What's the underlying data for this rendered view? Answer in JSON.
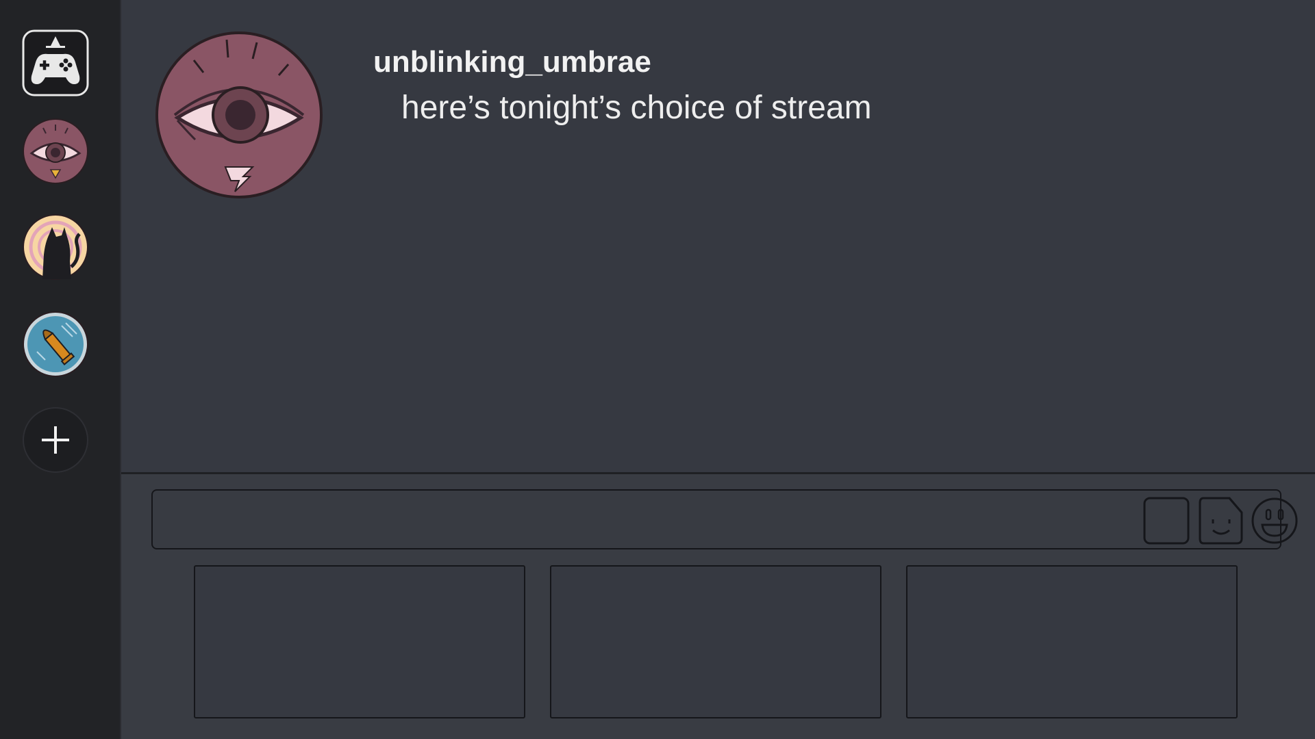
{
  "sidebar": {
    "items": [
      {
        "name": "home",
        "icon": "game-controller-icon"
      },
      {
        "name": "server-eye",
        "icon": "eye-icon"
      },
      {
        "name": "server-cat",
        "icon": "cat-icon"
      },
      {
        "name": "server-bullet",
        "icon": "bullet-icon"
      },
      {
        "name": "add-server",
        "icon": "plus-icon"
      }
    ]
  },
  "message": {
    "author": "unblinking_umbrae",
    "text": "here’s tonight’s choice of stream",
    "avatar_icon": "eye-icon"
  },
  "composer": {
    "placeholder": "",
    "value": "",
    "tools": [
      {
        "name": "box",
        "icon": "square-icon"
      },
      {
        "name": "sticker",
        "icon": "sticker-icon"
      },
      {
        "name": "emoji",
        "icon": "emoji-icon"
      }
    ]
  },
  "stream_options": [
    {
      "label": ""
    },
    {
      "label": ""
    },
    {
      "label": ""
    }
  ],
  "colors": {
    "background": "#363941",
    "rail": "#222326",
    "avatar_maroon": "#8a5565",
    "text": "#f2f2f2"
  }
}
